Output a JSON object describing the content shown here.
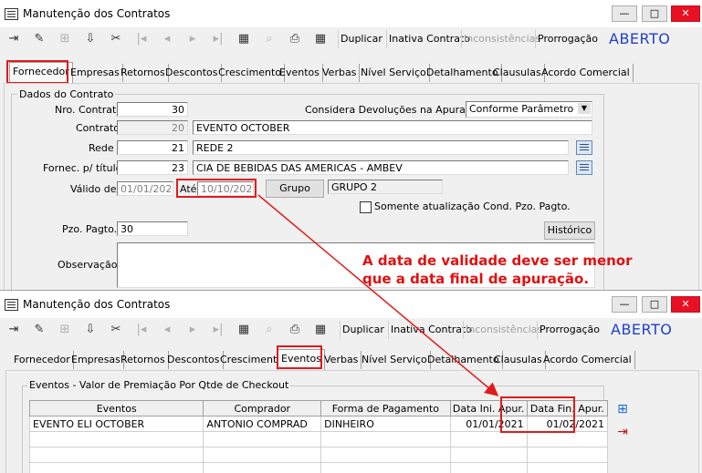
{
  "window": {
    "title": "Manutenção dos Contratos",
    "minimize": "—",
    "maximize": "□",
    "close": "✕"
  },
  "toolbar": {
    "icons": [
      "exit-icon",
      "edit-pencil-icon",
      "new-record-icon",
      "save-icon",
      "clear-icon",
      "first-record-icon",
      "prev-record-icon",
      "next-record-icon",
      "last-record-icon",
      "grid-view-icon",
      "search-icon",
      "print-icon",
      "calendar-grid-icon"
    ],
    "glyphs": [
      "⇥",
      "✎",
      "⊞",
      "⇩",
      "✂",
      "|◂",
      "◂",
      "▸",
      "▸|",
      "▦",
      "⌕",
      "⎙",
      "▦"
    ],
    "duplicar": "Duplicar",
    "inativa": "Inativa Contrato",
    "inconsistencias": "Inconsistências",
    "prorrogacao": "Prorrogação",
    "status": "ABERTO"
  },
  "tabs": [
    "Fornecedor",
    "Empresas",
    "Retornos",
    "Descontos",
    "Crescimento",
    "Eventos",
    "Verbas",
    "Nível Serviço",
    "Detalhamento",
    "Clausulas",
    "Acordo Comercial"
  ],
  "form": {
    "group_title": "Dados do Contrato",
    "nro_label": "Nro. Contrato",
    "nro_value": "30",
    "contrato_label": "Contrato",
    "contrato_num": "20",
    "contrato_name": "EVENTO OCTOBER",
    "rede_label": "Rede",
    "rede_num": "21",
    "rede_name": "REDE 2",
    "fornec_label": "Fornec. p/ título",
    "fornec_num": "23",
    "fornec_name": "CIA DE BEBIDAS DAS AMERICAS - AMBEV",
    "valido_label": "Válido de",
    "valido_de": "01/01/2021",
    "ate_label": "Até",
    "valido_ate": "10/10/2021",
    "grupo_button": "Grupo",
    "grupo_value": "GRUPO 2",
    "considera_label": "Considera Devoluções na Apuração",
    "considera_value": "Conforme Parâmetro",
    "somente_label": "Somente atualização Cond. Pzo. Pagto.",
    "pzo_label": "Pzo. Pagto.",
    "pzo_value": "30",
    "historico_button": "Histórico",
    "obs_label": "Observação",
    "obs_value": ""
  },
  "annotation": "A data de validade deve ser menor que a data final de apuração.",
  "eventos": {
    "group_title": "Eventos - Valor de Premiação Por Qtde de Checkout",
    "columns": [
      "Eventos",
      "Comprador",
      "Forma de Pagamento",
      "Data Ini. Apur.",
      "Data Fin. Apur."
    ],
    "rows": [
      [
        "EVENTO ELI OCTOBER",
        "ANTONIO COMPRAD",
        "DINHEIRO",
        "01/01/2021",
        "01/02/2021"
      ]
    ],
    "add_icon": "add-row-icon",
    "export_icon": "export-row-icon"
  },
  "colors": {
    "status_blue": "#1e3fcf",
    "highlight_red": "#e11b1b",
    "annotation_red": "#e01010"
  }
}
